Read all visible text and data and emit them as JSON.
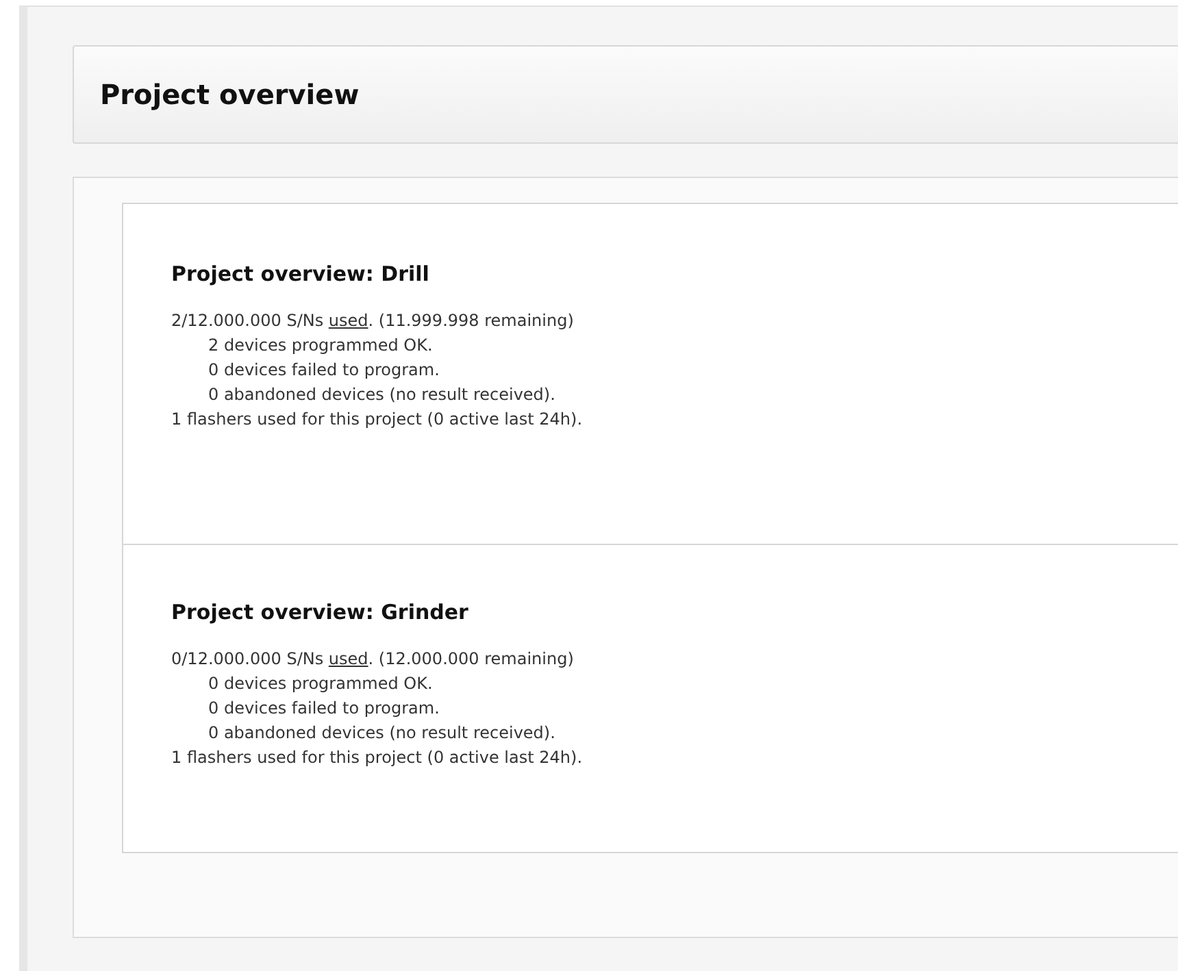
{
  "header": {
    "title": "Project overview"
  },
  "projects": [
    {
      "title": "Project overview: Drill",
      "summary": {
        "before": "2/12.000.000 S/Ns ",
        "link": "used",
        "after": ". (11.999.998 remaining)"
      },
      "lines": [
        {
          "text": "2 devices programmed OK.",
          "indented": true
        },
        {
          "text": "0 devices failed to program.",
          "indented": true
        },
        {
          "text": "0 abandoned devices (no result received).",
          "indented": true
        },
        {
          "text": "1 flashers used for this project (0 active last 24h).",
          "indented": false
        }
      ]
    },
    {
      "title": "Project overview: Grinder",
      "summary": {
        "before": "0/12.000.000 S/Ns ",
        "link": "used",
        "after": ". (12.000.000 remaining)"
      },
      "lines": [
        {
          "text": "0 devices programmed OK.",
          "indented": true
        },
        {
          "text": "0 devices failed to program.",
          "indented": true
        },
        {
          "text": "0 abandoned devices (no result received).",
          "indented": true
        },
        {
          "text": "1 flashers used for this project (0 active last 24h).",
          "indented": false
        }
      ]
    }
  ]
}
